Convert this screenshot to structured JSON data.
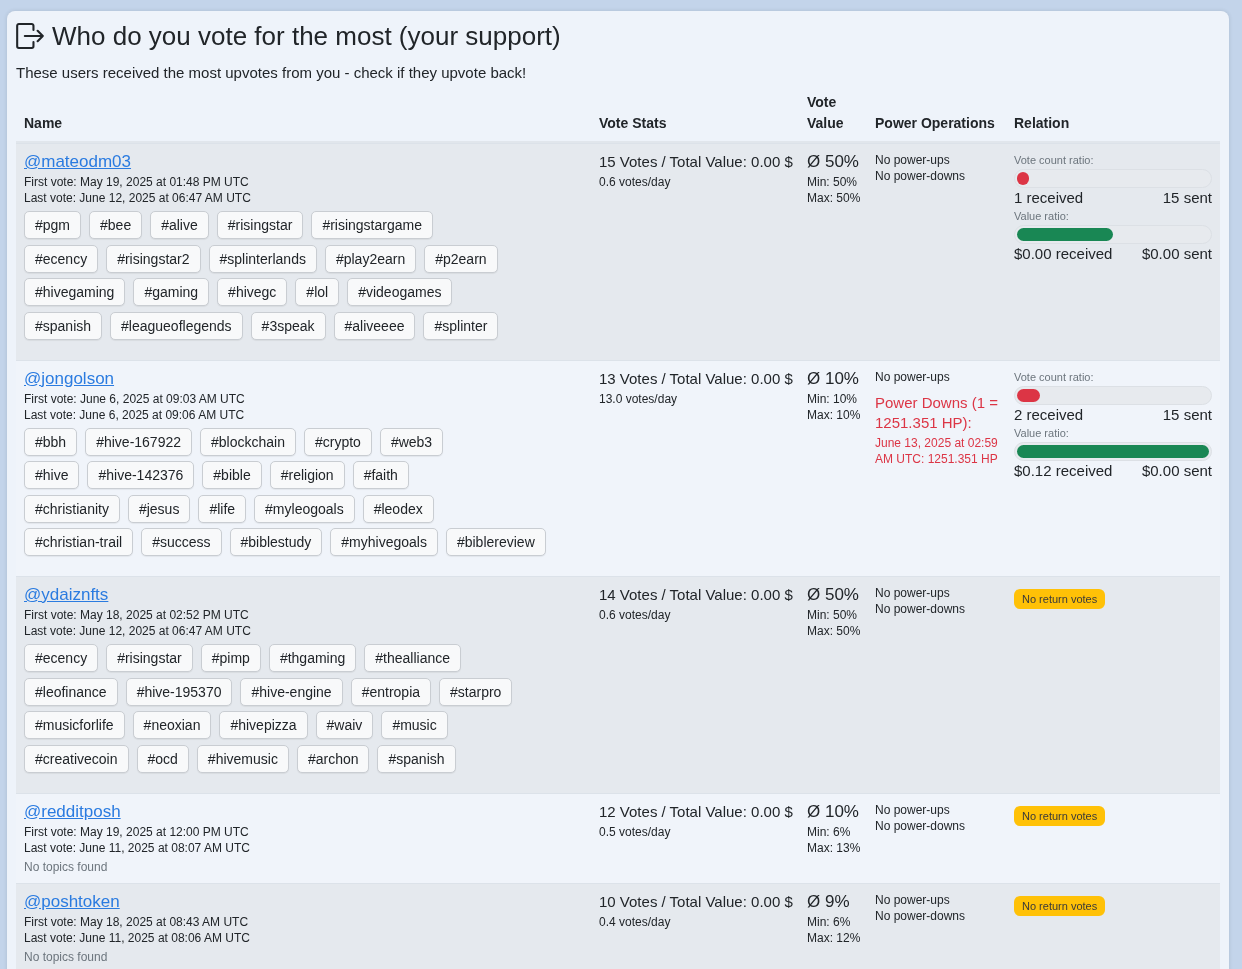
{
  "header": {
    "title": "Who do you vote for the most (your support)",
    "subtitle": "These users received the most upvotes from you - check if they upvote back!"
  },
  "table": {
    "columns": [
      "Name",
      "Vote Stats",
      "Vote Value",
      "Power Operations",
      "Relation"
    ],
    "rows": [
      {
        "user": "@mateodm03",
        "first_vote": "First vote: May 19, 2025 at 01:48 PM UTC",
        "last_vote": "Last vote: June 12, 2025 at 06:47 AM UTC",
        "tags": [
          "#pgm",
          "#bee",
          "#alive",
          "#risingstar",
          "#risingstargame",
          "#ecency",
          "#risingstar2",
          "#splinterlands",
          "#play2earn",
          "#p2earn",
          "#hivegaming",
          "#gaming",
          "#hivegc",
          "#lol",
          "#videogames",
          "#spanish",
          "#leagueoflegends",
          "#3speak",
          "#aliveeee",
          "#splinter"
        ],
        "votes": "15 Votes / Total Value: 0.00 $",
        "rate": "0.6 votes/day",
        "vote_value": {
          "average": "Ø 50%",
          "min": "Min: 50%",
          "max": "Max: 50%"
        },
        "power_operations": [
          {
            "kind": "plain",
            "text": "No power-ups"
          },
          {
            "kind": "plain",
            "text": "No power-downs"
          }
        ],
        "relation": {
          "kind": "ratios",
          "vote_count": {
            "label": "Vote count ratio:",
            "level": 0.0625,
            "received": "1 received",
            "sent": "15 sent"
          },
          "value": {
            "label": "Value ratio:",
            "level": 0.5,
            "received": "$0.00 received",
            "sent": "$0.00 sent"
          }
        }
      },
      {
        "user": "@jongolson",
        "first_vote": "First vote: June 6, 2025 at 09:03 AM UTC",
        "last_vote": "Last vote: June 6, 2025 at 09:06 AM UTC",
        "tags": [
          "#bbh",
          "#hive-167922",
          "#blockchain",
          "#crypto",
          "#web3",
          "#hive",
          "#hive-142376",
          "#bible",
          "#religion",
          "#faith",
          "#christianity",
          "#jesus",
          "#life",
          "#myleogoals",
          "#leodex",
          "#christian-trail",
          "#success",
          "#biblestudy",
          "#myhivegoals",
          "#biblereview"
        ],
        "votes": "13 Votes / Total Value: 0.00 $",
        "rate": "13.0 votes/day",
        "vote_value": {
          "average": "Ø 10%",
          "min": "Min: 10%",
          "max": "Max: 10%"
        },
        "power_operations": [
          {
            "kind": "plain",
            "text": "No power-ups"
          },
          {
            "kind": "power_down",
            "title": "Power Downs (1 = 1251.351 HP):",
            "detail": "June 13, 2025 at 02:59 AM UTC: 1251.351 HP"
          }
        ],
        "relation": {
          "kind": "ratios",
          "vote_count": {
            "label": "Vote count ratio:",
            "level": 0.118,
            "received": "2 received",
            "sent": "15 sent"
          },
          "value": {
            "label": "Value ratio:",
            "level": 1,
            "received": "$0.12 received",
            "sent": "$0.00 sent"
          }
        }
      },
      {
        "user": "@ydaiznfts",
        "first_vote": "First vote: May 18, 2025 at 02:52 PM UTC",
        "last_vote": "Last vote: June 12, 2025 at 06:47 AM UTC",
        "tags": [
          "#ecency",
          "#risingstar",
          "#pimp",
          "#thgaming",
          "#thealliance",
          "#leofinance",
          "#hive-195370",
          "#hive-engine",
          "#entropia",
          "#starpro",
          "#musicforlife",
          "#neoxian",
          "#hivepizza",
          "#waiv",
          "#music",
          "#creativecoin",
          "#ocd",
          "#hivemusic",
          "#archon",
          "#spanish"
        ],
        "votes": "14 Votes / Total Value: 0.00 $",
        "rate": "0.6 votes/day",
        "vote_value": {
          "average": "Ø 50%",
          "min": "Min: 50%",
          "max": "Max: 50%"
        },
        "power_operations": [
          {
            "kind": "plain",
            "text": "No power-ups"
          },
          {
            "kind": "plain",
            "text": "No power-downs"
          }
        ],
        "relation": {
          "kind": "badge",
          "text": "No return votes"
        }
      },
      {
        "user": "@redditposh",
        "first_vote": "First vote: May 19, 2025 at 12:00 PM UTC",
        "last_vote": "Last vote: June 11, 2025 at 08:07 AM UTC",
        "topics_note": "No topics found",
        "votes": "12 Votes / Total Value: 0.00 $",
        "rate": "0.5 votes/day",
        "vote_value": {
          "average": "Ø 10%",
          "min": "Min: 6%",
          "max": "Max: 13%"
        },
        "power_operations": [
          {
            "kind": "plain",
            "text": "No power-ups"
          },
          {
            "kind": "plain",
            "text": "No power-downs"
          }
        ],
        "relation": {
          "kind": "badge",
          "text": "No return votes"
        }
      },
      {
        "user": "@poshtoken",
        "first_vote": "First vote: May 18, 2025 at 08:43 AM UTC",
        "last_vote": "Last vote: June 11, 2025 at 08:06 AM UTC",
        "topics_note": "No topics found",
        "votes": "10 Votes / Total Value: 0.00 $",
        "rate": "0.4 votes/day",
        "vote_value": {
          "average": "Ø 9%",
          "min": "Min: 6%",
          "max": "Max: 12%"
        },
        "power_operations": [
          {
            "kind": "plain",
            "text": "No power-ups"
          },
          {
            "kind": "plain",
            "text": "No power-downs"
          }
        ],
        "relation": {
          "kind": "badge",
          "text": "No return votes"
        }
      }
    ]
  }
}
